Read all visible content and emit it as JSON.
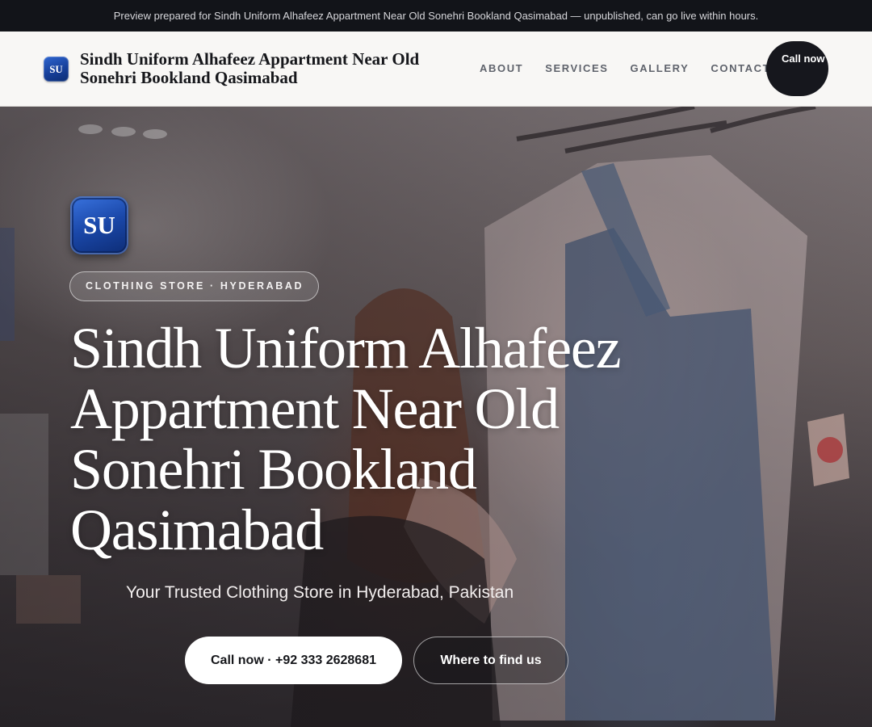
{
  "banner": {
    "text": "Preview prepared for Sindh Uniform Alhafeez Appartment Near Old Sonehri Bookland Qasimabad — unpublished, can go live within hours."
  },
  "header": {
    "logo_initials": "SU",
    "brand_name": "Sindh Uniform Alhafeez Appartment Near Old Sonehri Bookland Qasimabad",
    "nav": [
      {
        "label": "ABOUT"
      },
      {
        "label": "SERVICES"
      },
      {
        "label": "GALLERY"
      },
      {
        "label": "CONTACT"
      }
    ],
    "call_button": "Call now"
  },
  "hero": {
    "logo_initials": "SU",
    "tag": "CLOTHING STORE · HYDERABAD",
    "title": "Sindh Uniform Alhafeez Appartment Near Old Sonehri Bookland Qasimabad",
    "subtitle": "Your Trusted Clothing Store in Hyderabad, Pakistan",
    "primary_button": "Call now · +92 333 2628681",
    "secondary_button": "Where to find us",
    "background_image": "clothing-store-photo"
  },
  "colors": {
    "banner_bg": "#121419",
    "header_bg": "#f8f7f5",
    "accent_dark": "#16171d",
    "logo_blue": "#1a47a8"
  }
}
